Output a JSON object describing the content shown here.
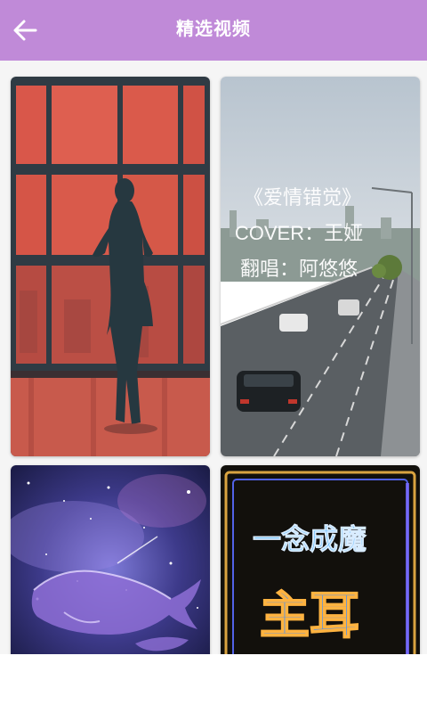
{
  "header": {
    "title": "精选视频",
    "back_icon": "arrow-left-icon"
  },
  "videos": [
    {
      "name": "silhouette-window"
    },
    {
      "name": "highway",
      "overlay_lines": [
        "《爱情错觉》",
        "COVER：王娅",
        "翻唱：阿悠悠"
      ]
    },
    {
      "name": "galaxy-whale"
    },
    {
      "name": "neon-sign",
      "sign_top": "一念成魔",
      "sign_bottom": "主耳"
    }
  ],
  "colors": {
    "appbar": "#c08ad8",
    "background": "#f5f5f5"
  }
}
